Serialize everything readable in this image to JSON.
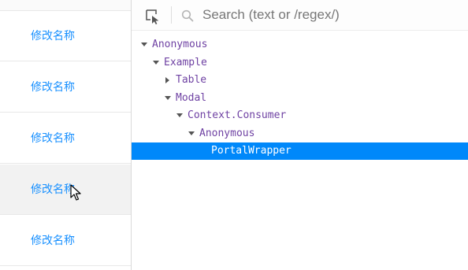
{
  "table": {
    "rows": [
      {
        "action": "修改名称"
      },
      {
        "action": "修改名称"
      },
      {
        "action": "修改名称"
      },
      {
        "action": "修改名称"
      },
      {
        "action": "修改名称"
      }
    ],
    "hovered_row_index": 3,
    "link_color": "#1890ff"
  },
  "devtools": {
    "search": {
      "placeholder": "Search (text or /regex/)",
      "value": ""
    },
    "tree": [
      {
        "label": "Anonymous",
        "expanded": true
      },
      {
        "label": "Example",
        "expanded": true
      },
      {
        "label": "Table",
        "expanded": false
      },
      {
        "label": "Modal",
        "expanded": true
      },
      {
        "label": "Context.Consumer",
        "expanded": true
      },
      {
        "label": "Anonymous",
        "expanded": true
      },
      {
        "label": "PortalWrapper",
        "selected": true
      }
    ],
    "component_name_color": "#6f42a3",
    "selection_color": "#0088fa"
  }
}
